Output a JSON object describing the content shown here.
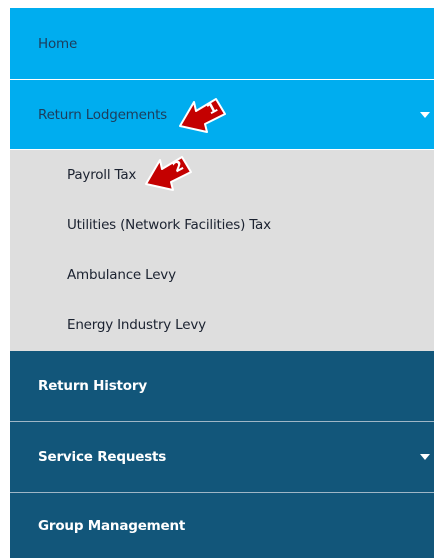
{
  "nav": {
    "home": "Home",
    "return_lodgements": "Return Lodgements",
    "sub_items": [
      "Payroll Tax",
      "Utilities (Network Facilities) Tax",
      "Ambulance Levy",
      "Energy Industry Levy"
    ],
    "return_history": "Return History",
    "service_requests": "Service Requests",
    "group_management": "Group Management"
  },
  "annotations": {
    "arrow_1": "1",
    "arrow_2": "2"
  },
  "colors": {
    "accent_light": "#00adef",
    "nav_dark": "#12567a",
    "submenu_bg": "#dedede",
    "arrow_red": "#c40000"
  }
}
